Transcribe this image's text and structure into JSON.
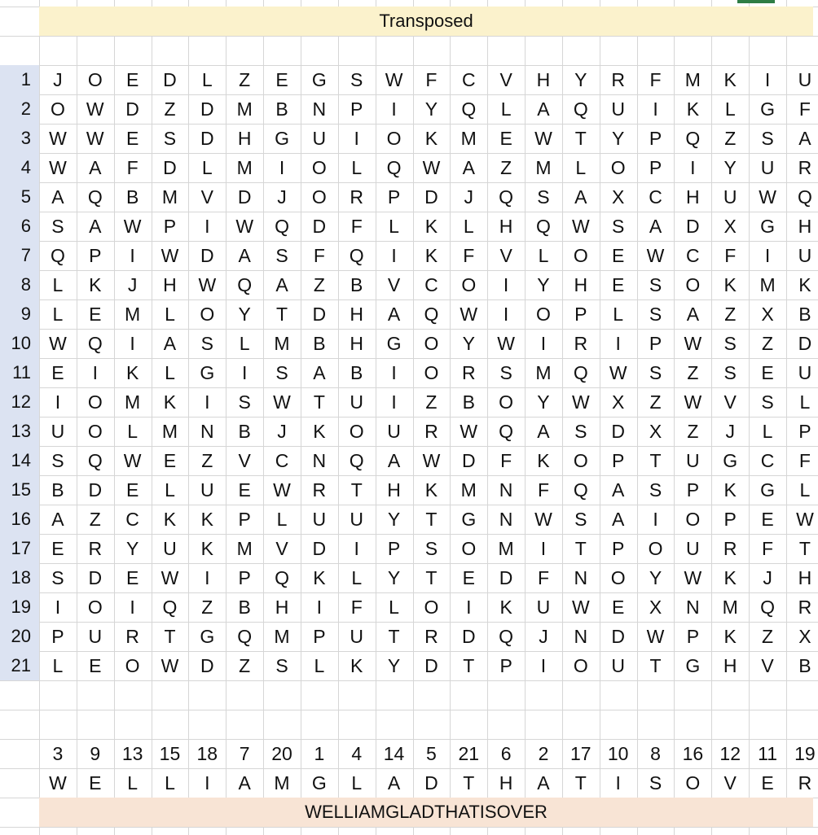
{
  "sheet": {
    "title": "Transposed",
    "row_numbers": [
      "1",
      "2",
      "3",
      "4",
      "5",
      "6",
      "7",
      "8",
      "9",
      "10",
      "11",
      "12",
      "13",
      "14",
      "15",
      "16",
      "17",
      "18",
      "19",
      "20",
      "21"
    ],
    "grid": [
      [
        "J",
        "O",
        "E",
        "D",
        "L",
        "Z",
        "E",
        "G",
        "S",
        "W",
        "F",
        "C",
        "V",
        "H",
        "Y",
        "R",
        "F",
        "M",
        "K",
        "I",
        "U"
      ],
      [
        "O",
        "W",
        "D",
        "Z",
        "D",
        "M",
        "B",
        "N",
        "P",
        "I",
        "Y",
        "Q",
        "L",
        "A",
        "Q",
        "U",
        "I",
        "K",
        "L",
        "G",
        "F"
      ],
      [
        "W",
        "W",
        "E",
        "S",
        "D",
        "H",
        "G",
        "U",
        "I",
        "O",
        "K",
        "M",
        "E",
        "W",
        "T",
        "Y",
        "P",
        "Q",
        "Z",
        "S",
        "A"
      ],
      [
        "W",
        "A",
        "F",
        "D",
        "L",
        "M",
        "I",
        "O",
        "L",
        "Q",
        "W",
        "A",
        "Z",
        "M",
        "L",
        "O",
        "P",
        "I",
        "Y",
        "U",
        "R"
      ],
      [
        "A",
        "Q",
        "B",
        "M",
        "V",
        "D",
        "J",
        "O",
        "R",
        "P",
        "D",
        "J",
        "Q",
        "S",
        "A",
        "X",
        "C",
        "H",
        "U",
        "W",
        "Q"
      ],
      [
        "S",
        "A",
        "W",
        "P",
        "I",
        "W",
        "Q",
        "D",
        "F",
        "L",
        "K",
        "L",
        "H",
        "Q",
        "W",
        "S",
        "A",
        "D",
        "X",
        "G",
        "H"
      ],
      [
        "Q",
        "P",
        "I",
        "W",
        "D",
        "A",
        "S",
        "F",
        "Q",
        "I",
        "K",
        "F",
        "V",
        "L",
        "O",
        "E",
        "W",
        "C",
        "F",
        "I",
        "U"
      ],
      [
        "L",
        "K",
        "J",
        "H",
        "W",
        "Q",
        "A",
        "Z",
        "B",
        "V",
        "C",
        "O",
        "I",
        "Y",
        "H",
        "E",
        "S",
        "O",
        "K",
        "M",
        "K"
      ],
      [
        "L",
        "E",
        "M",
        "L",
        "O",
        "Y",
        "T",
        "D",
        "H",
        "A",
        "Q",
        "W",
        "I",
        "O",
        "P",
        "L",
        "S",
        "A",
        "Z",
        "X",
        "B"
      ],
      [
        "W",
        "Q",
        "I",
        "A",
        "S",
        "L",
        "M",
        "B",
        "H",
        "G",
        "O",
        "Y",
        "W",
        "I",
        "R",
        "I",
        "P",
        "W",
        "S",
        "Z",
        "D"
      ],
      [
        "E",
        "I",
        "K",
        "L",
        "G",
        "I",
        "S",
        "A",
        "B",
        "I",
        "O",
        "R",
        "S",
        "M",
        "Q",
        "W",
        "S",
        "Z",
        "S",
        "E",
        "U"
      ],
      [
        "I",
        "O",
        "M",
        "K",
        "I",
        "S",
        "W",
        "T",
        "U",
        "I",
        "Z",
        "B",
        "O",
        "Y",
        "W",
        "X",
        "Z",
        "W",
        "V",
        "S",
        "L"
      ],
      [
        "U",
        "O",
        "L",
        "M",
        "N",
        "B",
        "J",
        "K",
        "O",
        "U",
        "R",
        "W",
        "Q",
        "A",
        "S",
        "D",
        "X",
        "Z",
        "J",
        "L",
        "P"
      ],
      [
        "S",
        "Q",
        "W",
        "E",
        "Z",
        "V",
        "C",
        "N",
        "Q",
        "A",
        "W",
        "D",
        "F",
        "K",
        "O",
        "P",
        "T",
        "U",
        "G",
        "C",
        "F"
      ],
      [
        "B",
        "D",
        "E",
        "L",
        "U",
        "E",
        "W",
        "R",
        "T",
        "H",
        "K",
        "M",
        "N",
        "F",
        "Q",
        "A",
        "S",
        "P",
        "K",
        "G",
        "L"
      ],
      [
        "A",
        "Z",
        "C",
        "K",
        "K",
        "P",
        "L",
        "U",
        "U",
        "Y",
        "T",
        "G",
        "N",
        "W",
        "S",
        "A",
        "I",
        "O",
        "P",
        "E",
        "W"
      ],
      [
        "E",
        "R",
        "Y",
        "U",
        "K",
        "M",
        "V",
        "D",
        "I",
        "P",
        "S",
        "O",
        "M",
        "I",
        "T",
        "P",
        "O",
        "U",
        "R",
        "F",
        "T"
      ],
      [
        "S",
        "D",
        "E",
        "W",
        "I",
        "P",
        "Q",
        "K",
        "L",
        "Y",
        "T",
        "E",
        "D",
        "F",
        "N",
        "O",
        "Y",
        "W",
        "K",
        "J",
        "H"
      ],
      [
        "I",
        "O",
        "I",
        "Q",
        "Z",
        "B",
        "H",
        "I",
        "F",
        "L",
        "O",
        "I",
        "K",
        "U",
        "W",
        "E",
        "X",
        "N",
        "M",
        "Q",
        "R"
      ],
      [
        "P",
        "U",
        "R",
        "T",
        "G",
        "Q",
        "M",
        "P",
        "U",
        "T",
        "R",
        "D",
        "Q",
        "J",
        "N",
        "D",
        "W",
        "P",
        "K",
        "Z",
        "X"
      ],
      [
        "L",
        "E",
        "O",
        "W",
        "D",
        "Z",
        "S",
        "L",
        "K",
        "Y",
        "D",
        "T",
        "P",
        "I",
        "O",
        "U",
        "T",
        "G",
        "H",
        "V",
        "B"
      ]
    ],
    "key_numbers": [
      "3",
      "9",
      "13",
      "15",
      "18",
      "7",
      "20",
      "1",
      "4",
      "14",
      "5",
      "21",
      "6",
      "2",
      "17",
      "10",
      "8",
      "16",
      "12",
      "11",
      "19"
    ],
    "key_letters": [
      "W",
      "E",
      "L",
      "L",
      "I",
      "A",
      "M",
      "G",
      "L",
      "A",
      "D",
      "T",
      "H",
      "A",
      "T",
      "I",
      "S",
      "O",
      "V",
      "E",
      "R"
    ],
    "result": "WELLIAMGLADTHATISOVER"
  }
}
